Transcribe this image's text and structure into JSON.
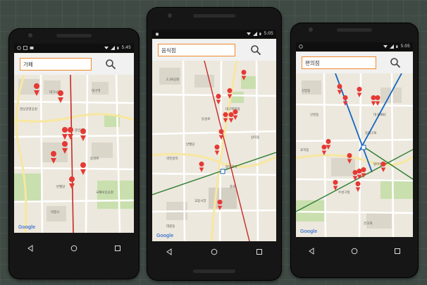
{
  "phones": [
    {
      "search_value": "가페",
      "time": "5:45",
      "logo": "Google"
    },
    {
      "search_value": "음식점",
      "time": "5:05",
      "logo": "Google"
    },
    {
      "search_value": "편의점",
      "time": "5:05",
      "logo": "Google"
    }
  ],
  "icons": {
    "search": "search-icon",
    "back": "back-icon",
    "home": "home-icon",
    "recents": "recents-icon",
    "marker": "map-marker-icon"
  },
  "colors": {
    "search_border": "#f08a2a",
    "marker": "#e53935",
    "subway_red": "#c62828",
    "subway_blue": "#1565c0",
    "subway_green": "#2e7d32"
  },
  "map_labels": {
    "phone1": [
      "대구시청",
      "중앙로",
      "반월당",
      "동성로",
      "약령시",
      "경상감영공원",
      "대구역",
      "국채보상공원"
    ],
    "phone2": [
      "중앙로역",
      "동성로",
      "반월당",
      "대구백화점",
      "2.28공원",
      "약전골목",
      "교동시장",
      "종로",
      "삼덕동",
      "대봉동"
    ],
    "phone3": [
      "동대구로",
      "신천동",
      "범어동",
      "효목동",
      "수성구청",
      "대구MBC",
      "신암동",
      "큰고개"
    ]
  }
}
